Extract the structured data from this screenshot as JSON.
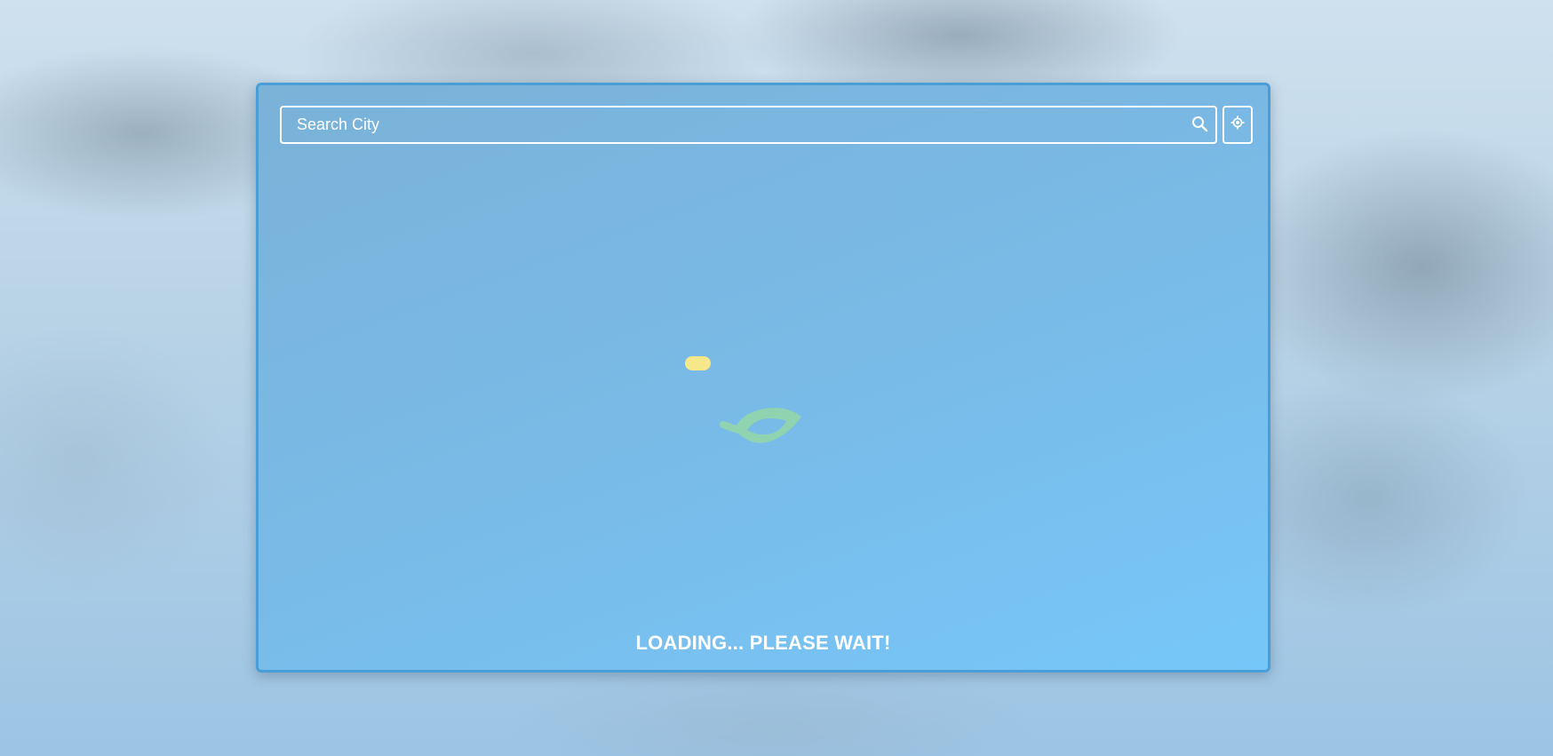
{
  "search": {
    "placeholder": "Search City",
    "value": "",
    "search_icon": "search-icon",
    "locate_icon": "crosshair-location-icon"
  },
  "status": {
    "loading_text": "LOADING... PLEASE WAIT!"
  },
  "loader": {
    "sun_icon": "sun-pill-icon",
    "leaf_icon": "leaf-icon",
    "sun_color": "#f6e88a",
    "leaf_color": "#8fd3b0"
  },
  "colors": {
    "card_border": "#4a9ed8",
    "card_start": "#7ab2d8",
    "card_end": "#76c7f9",
    "text": "#ffffff"
  }
}
